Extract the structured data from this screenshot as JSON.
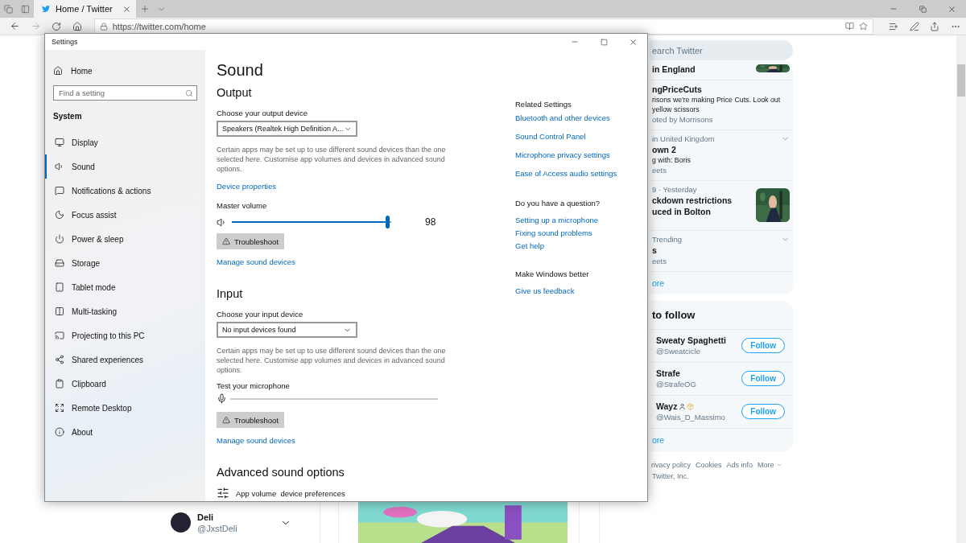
{
  "browser": {
    "tab": {
      "title": "Home / Twitter",
      "selected": true
    },
    "address": "https://twitter.com/home"
  },
  "twitter": {
    "search": {
      "placeholder": "earch Twitter"
    },
    "trends": [
      {
        "kind": "top",
        "title": "in England",
        "picture": true
      },
      {
        "kind": "promoted",
        "title": "ngPriceCuts",
        "body": "risons we're making Price Cuts. Look out",
        "body2": "yellow scissors",
        "meta": "oted by Morrisons"
      },
      {
        "kind": "trend",
        "context": "in United Kingdom",
        "title": "own 2",
        "body": "g with: Boris",
        "meta": "eets"
      },
      {
        "kind": "news",
        "context": "9 · Yesterday",
        "title": "ckdown restrictions",
        "title2": "uced in Bolton",
        "picture": true
      },
      {
        "kind": "trend",
        "context": "Trending",
        "title": "s",
        "meta": "eets"
      }
    ],
    "trends_more": "ore",
    "follow_heading": "to follow",
    "follow": [
      {
        "name": "Sweaty Spaghetti",
        "handle": "@Sweatcicle",
        "button": "Follow"
      },
      {
        "name": "Strafe",
        "handle": "@StrafeOG",
        "button": "Follow"
      },
      {
        "name": "Wayz",
        "handle": "@Wais_D_Massimo",
        "button": "Follow",
        "emoji": true
      }
    ],
    "follow_more": "ore",
    "footer": [
      "rivacy policy",
      "Cookies",
      "Ads info",
      "More"
    ],
    "copyright": "Twitter, Inc.",
    "account": {
      "name": "Deli",
      "handle": "@JxstDeli"
    }
  },
  "settings": {
    "title": "Settings",
    "home": "Home",
    "search": {
      "placeholder": "Find a setting"
    },
    "section": "System",
    "nav": [
      {
        "label": "Display",
        "selected": false
      },
      {
        "label": "Sound",
        "selected": true
      },
      {
        "label": "Notifications & actions",
        "selected": false
      },
      {
        "label": "Focus assist",
        "selected": false
      },
      {
        "label": "Power & sleep",
        "selected": false
      },
      {
        "label": "Storage",
        "selected": false
      },
      {
        "label": "Tablet mode",
        "selected": false
      },
      {
        "label": "Multi-tasking",
        "selected": false
      },
      {
        "label": "Projecting to this PC",
        "selected": false
      },
      {
        "label": "Shared experiences",
        "selected": false
      },
      {
        "label": "Clipboard",
        "selected": false
      },
      {
        "label": "Remote Desktop",
        "selected": false
      },
      {
        "label": "About",
        "selected": false
      }
    ],
    "page_title": "Sound",
    "output": {
      "heading": "Output",
      "device_label": "Choose your output device",
      "device": "Speakers (Realtek High Definition A...",
      "note": "Certain apps may be set up to use different sound devices than the one selected here. Customise app volumes and devices in advanced sound options.",
      "link": "Device properties",
      "volume_label": "Master volume",
      "volume": {
        "level": 0.98,
        "reading": "98"
      },
      "troubleshoot": "Troubleshoot",
      "manage": "Manage sound devices"
    },
    "input": {
      "heading": "Input",
      "device_label": "Choose your input device",
      "device": "No input devices found",
      "note": "Certain apps may be set up to use different sound devices than the one selected here. Customise app volumes and devices in advanced sound options.",
      "test_label": "Test your microphone",
      "troubleshoot": "Troubleshoot",
      "manage": "Manage sound devices"
    },
    "advanced": {
      "heading": "Advanced sound options",
      "item": "App volume  device preferences"
    },
    "related": [
      {
        "heading": "Related Settings",
        "links": [
          "Bluetooth and other devices",
          "Sound Control Panel",
          "Microphone privacy settings",
          "Ease of Access audio settings"
        ]
      },
      {
        "heading": "Do you have a question?",
        "links": [
          "Setting up a microphone",
          "Fixing sound problems",
          "Get help"
        ]
      },
      {
        "heading": "Make Windows better",
        "links": [
          "Give us feedback"
        ]
      }
    ]
  }
}
